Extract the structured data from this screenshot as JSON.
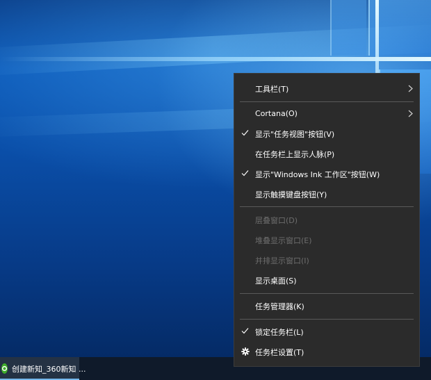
{
  "taskbar": {
    "app_label": "创建新知_360新知 ..."
  },
  "context_menu": {
    "items": [
      {
        "label": "工具栏(T)",
        "checked": false,
        "disabled": false,
        "submenu": true
      },
      {
        "label": "Cortana(O)",
        "checked": false,
        "disabled": false,
        "submenu": true
      },
      {
        "label": "显示\"任务视图\"按钮(V)",
        "checked": true,
        "disabled": false,
        "submenu": false
      },
      {
        "label": "在任务栏上显示人脉(P)",
        "checked": false,
        "disabled": false,
        "submenu": false
      },
      {
        "label": "显示\"Windows Ink 工作区\"按钮(W)",
        "checked": true,
        "disabled": false,
        "submenu": false
      },
      {
        "label": "显示触摸键盘按钮(Y)",
        "checked": false,
        "disabled": false,
        "submenu": false
      },
      {
        "label": "层叠窗口(D)",
        "checked": false,
        "disabled": true,
        "submenu": false
      },
      {
        "label": "堆叠显示窗口(E)",
        "checked": false,
        "disabled": true,
        "submenu": false
      },
      {
        "label": "并排显示窗口(I)",
        "checked": false,
        "disabled": true,
        "submenu": false
      },
      {
        "label": "显示桌面(S)",
        "checked": false,
        "disabled": false,
        "submenu": false
      },
      {
        "label": "任务管理器(K)",
        "checked": false,
        "disabled": false,
        "submenu": false
      },
      {
        "label": "锁定任务栏(L)",
        "checked": true,
        "disabled": false,
        "submenu": false
      },
      {
        "label": "任务栏设置(T)",
        "checked": false,
        "disabled": false,
        "submenu": false,
        "icon": "gear-icon"
      }
    ]
  },
  "colors": {
    "menu_bg": "#2b2b2b",
    "menu_text": "#ffffff",
    "menu_disabled_text": "#6d6d6d",
    "taskbar_bg": "#0f1a2a",
    "taskbar_accent": "#76b9ed"
  }
}
